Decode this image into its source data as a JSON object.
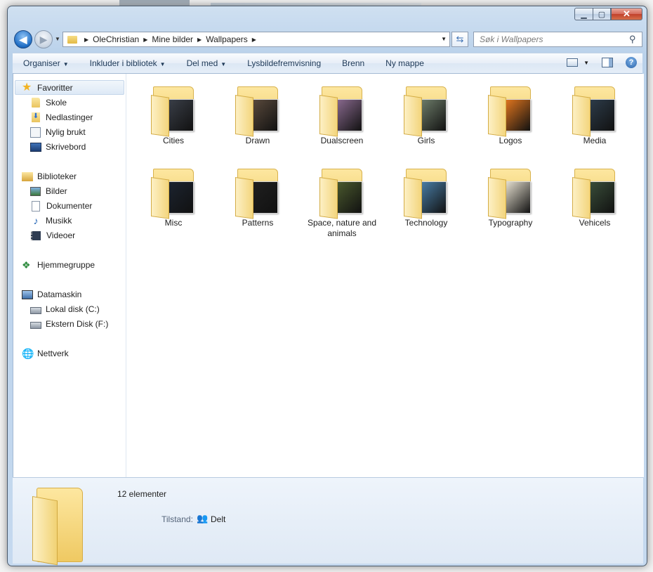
{
  "window": {
    "caption_buttons": {
      "minimize": "▁",
      "maximize": "▢",
      "close": "✕"
    }
  },
  "address": {
    "crumbs": [
      "OleChristian",
      "Mine bilder",
      "Wallpapers"
    ],
    "search_placeholder": "Søk i Wallpapers"
  },
  "toolbar": {
    "organize": "Organiser",
    "include_library": "Inkluder i bibliotek",
    "share": "Del med",
    "slideshow": "Lysbildefremvisning",
    "burn": "Brenn",
    "new_folder": "Ny mappe"
  },
  "nav": {
    "favorites": "Favoritter",
    "favorites_items": [
      "Skole",
      "Nedlastinger",
      "Nylig brukt",
      "Skrivebord"
    ],
    "libraries": "Biblioteker",
    "libraries_items": [
      "Bilder",
      "Dokumenter",
      "Musikk",
      "Videoer"
    ],
    "homegroup": "Hjemmegruppe",
    "computer": "Datamaskin",
    "computer_items": [
      "Lokal disk (C:)",
      "Ekstern Disk (F:)"
    ],
    "network": "Nettverk"
  },
  "folders": [
    {
      "name": "Cities",
      "thumb": "#3a3f48"
    },
    {
      "name": "Drawn",
      "thumb": "#5a4a3c"
    },
    {
      "name": "Dualscreen",
      "thumb": "#8a6a8f"
    },
    {
      "name": "Girls",
      "thumb": "#6e7d6a"
    },
    {
      "name": "Logos",
      "thumb": "#e2761e"
    },
    {
      "name": "Media",
      "thumb": "#2d3c4a"
    },
    {
      "name": "Misc",
      "thumb": "#1c2430"
    },
    {
      "name": "Patterns",
      "thumb": "#202020"
    },
    {
      "name": "Space, nature and animals",
      "thumb": "#4b5a2e"
    },
    {
      "name": "Technology",
      "thumb": "#4a7fa8"
    },
    {
      "name": "Typography",
      "thumb": "#e8e2d2"
    },
    {
      "name": "Vehicels",
      "thumb": "#3a4f3a"
    }
  ],
  "details": {
    "count": "12 elementer",
    "state_label": "Tilstand:",
    "state_value": "Delt"
  }
}
